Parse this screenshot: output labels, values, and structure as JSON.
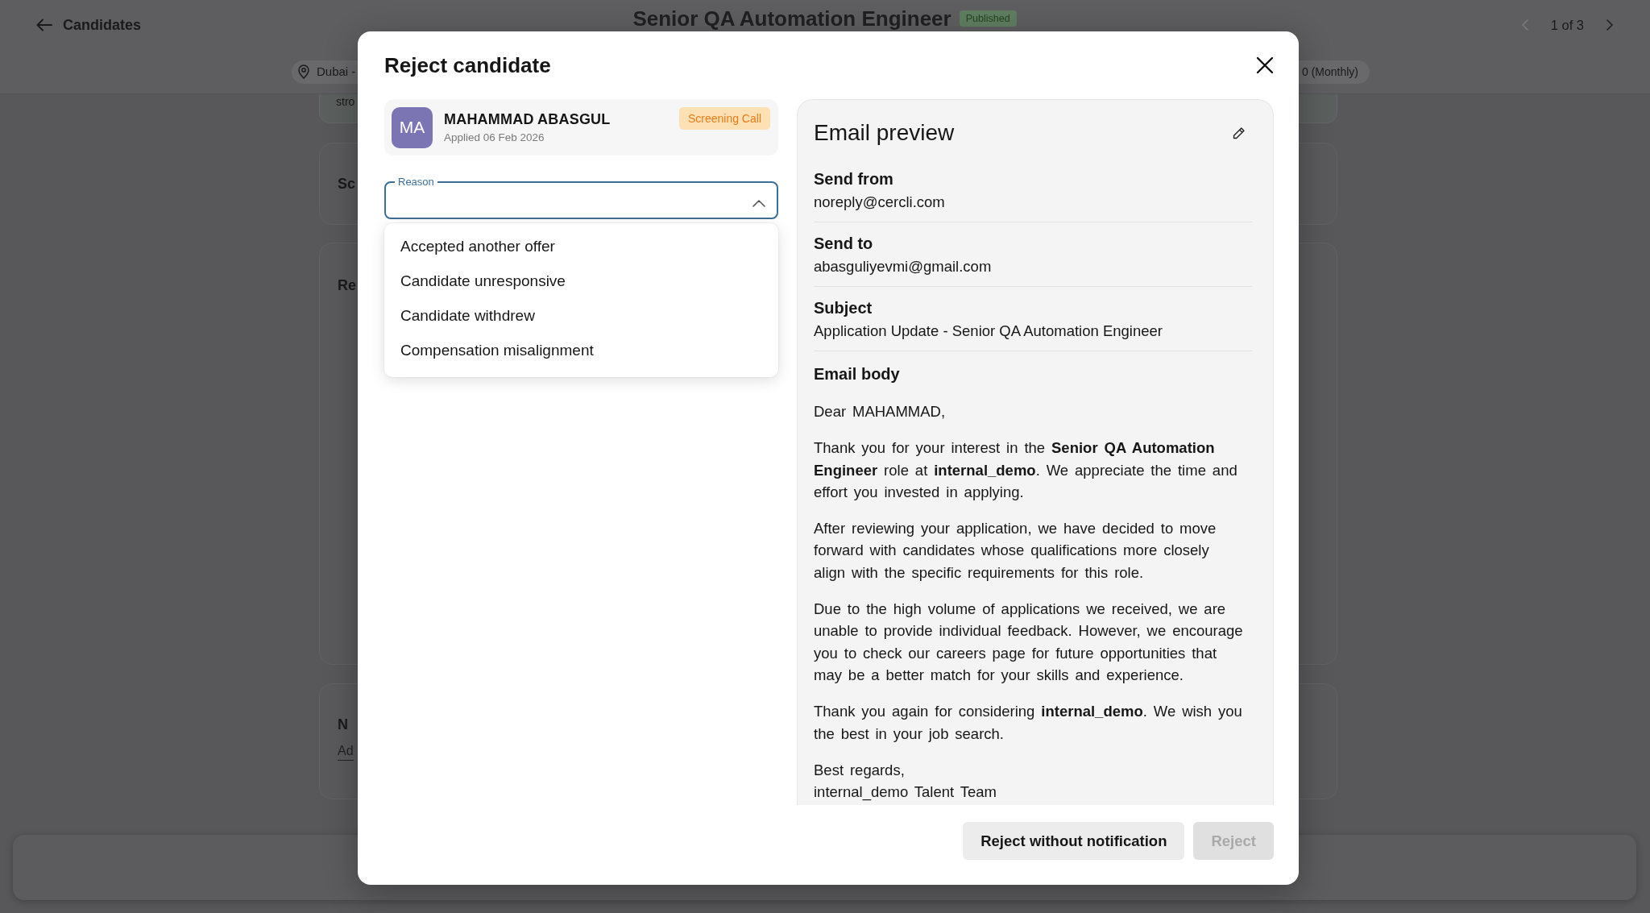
{
  "page": {
    "header": {
      "back_label": "Candidates",
      "title": "Senior QA Automation Engineer",
      "status": "Published",
      "pager": {
        "label": "1 of 3",
        "prev_disabled": true,
        "next_disabled": false
      },
      "location": "Dubai -",
      "salary": "0 (Monthly)"
    },
    "cards": [
      {
        "text": "stro"
      },
      {
        "heading": "Sc"
      },
      {
        "heading": "Re"
      },
      {
        "heading": "N",
        "placeholder": "Ad"
      }
    ]
  },
  "modal": {
    "title": "Reject candidate",
    "candidate": {
      "initials": "MA",
      "name": "MAHAMMAD ABASGUL",
      "applied": "Applied 06 Feb 2026",
      "stage": "Screening Call"
    },
    "reason": {
      "label": "Reason",
      "expanded": true,
      "options": [
        {
          "label": "Accepted another offer",
          "selected": false
        },
        {
          "label": "Candidate unresponsive",
          "selected": false
        },
        {
          "label": "Candidate withdrew",
          "selected": false
        },
        {
          "label": "Compensation misalignment",
          "selected": false
        }
      ]
    },
    "email_preview": {
      "title": "Email preview",
      "fields": [
        {
          "label": "Send from",
          "value": "noreply@cercli.com"
        },
        {
          "label": "Send to",
          "value": "abasguliyevmi@gmail.com"
        },
        {
          "label": "Subject",
          "value": "Application Update - Senior QA Automation Engineer"
        }
      ],
      "body_label": "Email body",
      "body": [
        "Dear MAHAMMAD,",
        "Thank you for your interest in the **Senior QA Automation Engineer** role at **internal_demo**. We appreciate the time and effort you invested in applying.",
        "After reviewing your application, we have decided to move forward with candidates whose qualifications more closely align with the specific requirements for this role.",
        "Due to the high volume of applications we received, we are unable to provide individual feedback. However, we encourage you to check our careers page for future opportunities that may be a better match for your skills and experience.",
        "Thank you again for considering **internal_demo**. We wish you the best in your job search.",
        "Best regards,\ninternal_demo Talent Team"
      ]
    },
    "buttons": [
      {
        "label": "Reject without notification",
        "kind": "secondary",
        "disabled": false
      },
      {
        "label": "Reject",
        "kind": "primary",
        "disabled": true
      }
    ]
  }
}
